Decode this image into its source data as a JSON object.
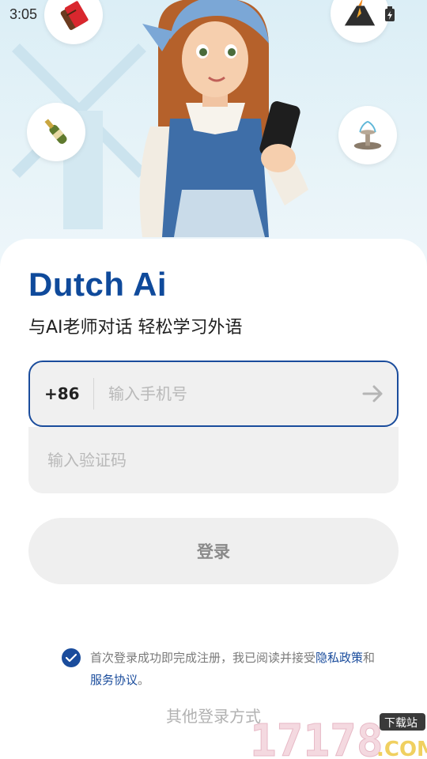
{
  "status_bar": {
    "time": "3:05"
  },
  "hero": {
    "icons": [
      "chocolate-icon",
      "champagne-icon",
      "volcano-icon",
      "fountain-icon"
    ]
  },
  "brand": {
    "title": "Dutch Ai",
    "tagline": "与AI老师对话 轻松学习外语"
  },
  "phone": {
    "country_code": "+86",
    "placeholder": "输入手机号"
  },
  "code": {
    "placeholder": "输入验证码"
  },
  "login": {
    "label": "登录"
  },
  "agreement": {
    "prefix": "首次登录成功即完成注册，我已阅读并接受",
    "privacy": "隐私政策",
    "and": "和",
    "service": "服务协议",
    "suffix": "。",
    "checked": true
  },
  "other_login": {
    "label": "其他登录方式"
  },
  "watermark": {
    "site": "17178",
    "tag": "下载站",
    "domain": ".COM"
  },
  "colors": {
    "brand": "#0f4a9b",
    "accent": "#1a4c9c"
  }
}
